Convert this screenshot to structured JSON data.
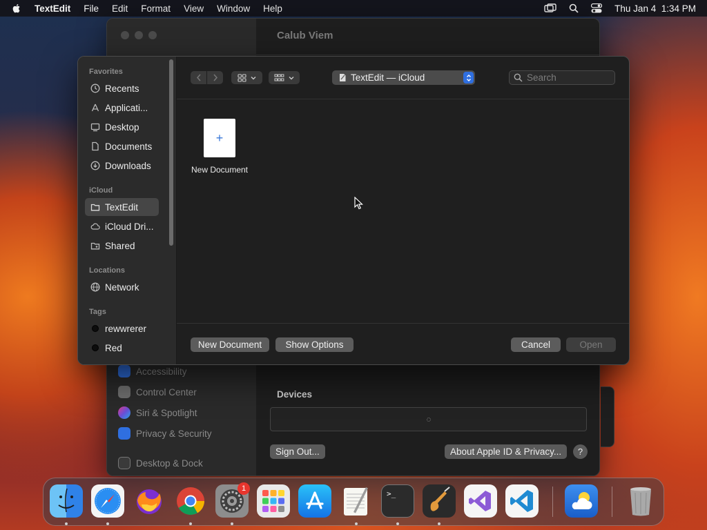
{
  "menubar": {
    "app_name": "TextEdit",
    "items": [
      "File",
      "Edit",
      "Format",
      "View",
      "Window",
      "Help"
    ],
    "clock": "Thu Jan 4  1:34 PM"
  },
  "background_window": {
    "title": "Calub Viem",
    "sidebar_items": [
      "Accessibility",
      "Control Center",
      "Siri & Spotlight",
      "Privacy & Security",
      "Desktop & Dock"
    ],
    "devices_label": "Devices",
    "sign_out_label": "Sign Out...",
    "about_label": "About Apple ID & Privacy...",
    "help_label": "?"
  },
  "dialog": {
    "sidebar": {
      "favorites_header": "Favorites",
      "favorites": [
        "Recents",
        "Applicati...",
        "Desktop",
        "Documents",
        "Downloads"
      ],
      "icloud_header": "iCloud",
      "icloud": [
        "TextEdit",
        "iCloud Dri...",
        "Shared"
      ],
      "locations_header": "Locations",
      "locations": [
        "Network"
      ],
      "tags_header": "Tags",
      "tags": [
        "rewwrerer",
        "Red"
      ]
    },
    "location": "TextEdit — iCloud",
    "search_placeholder": "Search",
    "files": [
      {
        "name": "New Document",
        "glyph": "+"
      }
    ],
    "buttons": {
      "new_document": "New Document",
      "show_options": "Show Options",
      "cancel": "Cancel",
      "open": "Open"
    }
  },
  "dock": {
    "apps": [
      "Finder",
      "Safari",
      "Firefox",
      "Chrome",
      "System Settings",
      "Launchpad",
      "App Store",
      "TextEdit",
      "Terminal",
      "GarageBand",
      "Visual Studio",
      "VS Code",
      "Weather",
      "Trash"
    ],
    "settings_badge": "1",
    "terminal_glyph": ">_"
  },
  "colors": {
    "accent": "#2f6fe0",
    "dialog_bg": "#1f1f1f",
    "sidebar_bg": "#2b2b2b",
    "badge": "#e8352d"
  }
}
